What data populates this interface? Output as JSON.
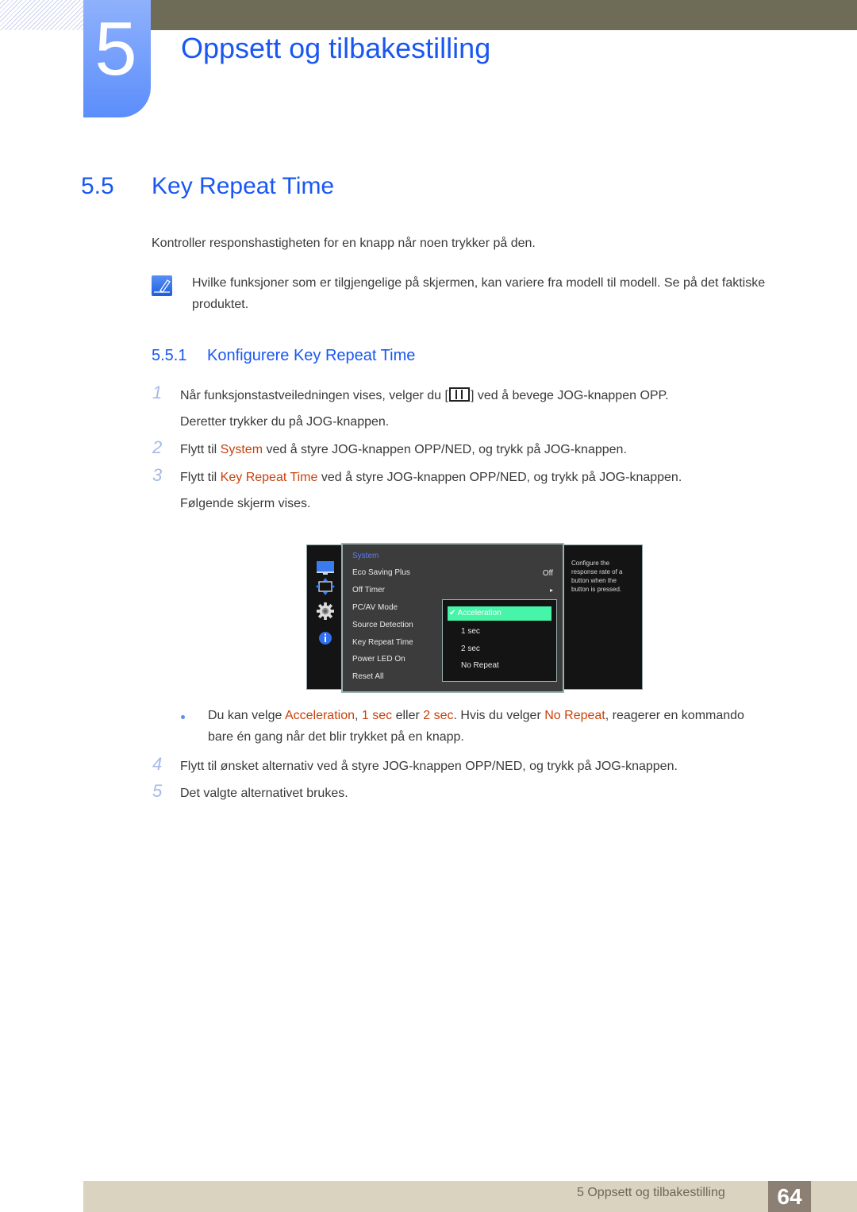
{
  "header": {
    "chapter_number": "5",
    "chapter_title": "Oppsett og tilbakestilling"
  },
  "section": {
    "number": "5.5",
    "title": "Key Repeat Time",
    "intro": "Kontroller responshastigheten for en knapp når noen trykker på den.",
    "note": "Hvilke funksjoner som er tilgjengelige på skjermen, kan variere fra modell til modell. Se på det faktiske produktet."
  },
  "subsection": {
    "number": "5.5.1",
    "title": "Konfigurere Key Repeat Time"
  },
  "steps": [
    {
      "num": "1",
      "text_a": "Når funksjonstastveiledningen vises, velger du [",
      "icon": "menu-icon",
      "text_b": "] ved å bevege JOG-knappen OPP.",
      "text_c": "Deretter trykker du på JOG-knappen."
    },
    {
      "num": "2",
      "pre": "Flytt til ",
      "hl": "System",
      "post": " ved å styre JOG-knappen OPP/NED, og trykk på JOG-knappen."
    },
    {
      "num": "3",
      "pre": "Flytt til ",
      "hl": "Key Repeat Time",
      "post": " ved å styre JOG-knappen OPP/NED, og trykk på JOG-knappen.",
      "line2": "Følgende skjerm vises."
    },
    {
      "num": "4",
      "text": "Flytt til ønsket alternativ ved å styre JOG-knappen OPP/NED, og trykk på JOG-knappen."
    },
    {
      "num": "5",
      "text": "Det valgte alternativet brukes."
    }
  ],
  "osd": {
    "side_icons": [
      "picture-icon",
      "position-icon",
      "gear-icon",
      "info-icon"
    ],
    "menu_header": "System",
    "menu_items": [
      {
        "label": "Eco Saving Plus",
        "value": "Off"
      },
      {
        "label": "Off Timer",
        "value": "▸"
      },
      {
        "label": "PC/AV Mode",
        "value": ""
      },
      {
        "label": "Source Detection",
        "value": ""
      },
      {
        "label": "Key Repeat Time",
        "value": ""
      },
      {
        "label": "Power LED On",
        "value": ""
      },
      {
        "label": "Reset All",
        "value": ""
      }
    ],
    "options": [
      "Acceleration",
      "1 sec",
      "2 sec",
      "No Repeat"
    ],
    "selected_option": "Acceleration",
    "help_text": "Configure the response rate of a button when the button is pressed.",
    "accent_color": "#46f5a8"
  },
  "bullet": {
    "a": "Du kan velge ",
    "h1": "Acceleration",
    "b": ", ",
    "h2": "1 sec",
    "c": " eller ",
    "h3": "2 sec",
    "d": ". Hvis du velger ",
    "h4": "No Repeat",
    "e": ", reagerer en kommando bare én gang når det blir trykket på en knapp."
  },
  "footer": {
    "chapter_label": "5 Oppsett og tilbakestilling",
    "page_number": "64"
  },
  "colors": {
    "heading_blue": "#1a57f2",
    "highlight_orange": "#c8410c",
    "topbar": "#6e6b57",
    "footer_bar": "#d9d3c0",
    "page_box": "#8c7f73"
  }
}
